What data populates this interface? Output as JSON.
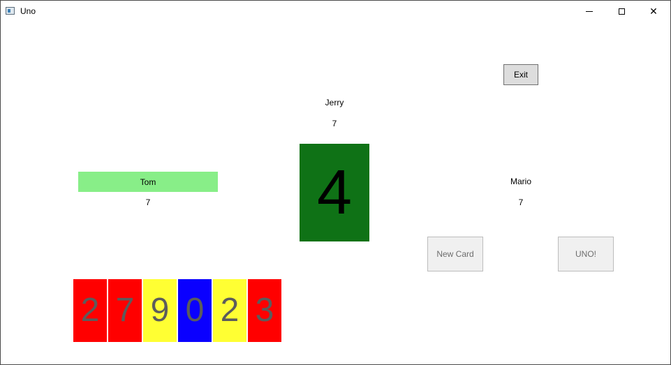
{
  "window": {
    "title": "Uno"
  },
  "colors": {
    "active_player_bg": "#88ee88",
    "pile_card_bg": "#0f7216",
    "red": "#ff0000",
    "yellow": "#ffff33",
    "blue": "#0a00ff"
  },
  "exit_label": "Exit",
  "players": {
    "top": {
      "name": "Jerry",
      "count": "7"
    },
    "left": {
      "name": "Tom",
      "count": "7",
      "active": true
    },
    "right": {
      "name": "Mario",
      "count": "7"
    }
  },
  "pile_card": {
    "value": "4",
    "color": "#0f7216"
  },
  "buttons": {
    "new_card": "New Card",
    "uno": "UNO!"
  },
  "hand": [
    {
      "value": "2",
      "color": "#ff0000"
    },
    {
      "value": "7",
      "color": "#ff0000"
    },
    {
      "value": "9",
      "color": "#ffff33"
    },
    {
      "value": "0",
      "color": "#0a00ff"
    },
    {
      "value": "2",
      "color": "#ffff33"
    },
    {
      "value": "3",
      "color": "#ff0000"
    }
  ]
}
